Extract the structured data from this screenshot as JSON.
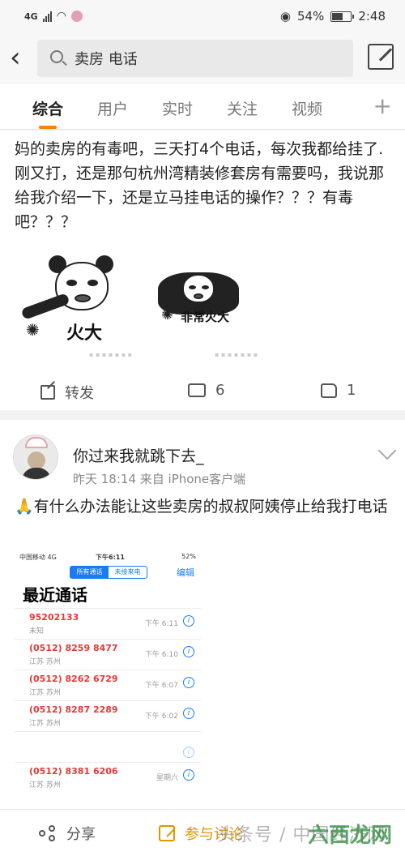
{
  "status_bar": {
    "network": "4G",
    "battery": "54%",
    "time": "2:48"
  },
  "search": {
    "query": "卖房 电话"
  },
  "tabs": [
    {
      "label": "综合",
      "active": true
    },
    {
      "label": "用户"
    },
    {
      "label": "实时"
    },
    {
      "label": "关注"
    },
    {
      "label": "视频"
    }
  ],
  "post1": {
    "text": "妈的卖房的有毒吧，三天打4个电话，每次我都给挂了.刚又打，还是那句杭州湾精装修套房有需要吗，我说那给我介绍一下，还是立马挂电话的操作？？？有毒吧？？？",
    "meme1_text": "火大",
    "meme2_text": "非常火大",
    "repost_label": "转发",
    "comment_count": "6",
    "like_count": "1"
  },
  "post2": {
    "username": "你过来我就跳下去_",
    "meta": "昨天 18:14  来自 iPhone客户端",
    "text": "有什么办法能让这些卖房的叔叔阿姨停止给我打电话",
    "screenshot": {
      "carrier": "中国移动  4G",
      "time": "下午6:11",
      "battery": "52%",
      "segment_all": "所有通话",
      "segment_missed": "未接来电",
      "edit": "编辑",
      "title": "最近通话",
      "calls": [
        {
          "number": "95202133",
          "location": "未知",
          "time": "下午 6:11"
        },
        {
          "number": "(0512) 8259 8477",
          "location": "江苏 苏州",
          "time": "下午 6:10"
        },
        {
          "number": "(0512) 8262 6729",
          "location": "江苏 苏州",
          "time": "下午 6:07"
        },
        {
          "number": "(0512) 8287 2289",
          "location": "江苏 苏州",
          "time": "下午 6:02"
        },
        {
          "number": "",
          "location": "",
          "time": ""
        },
        {
          "number": "(0512) 8381 6206",
          "location": "江苏 苏州",
          "time": "星期六"
        }
      ]
    }
  },
  "bottom_bar": {
    "share": "分享",
    "discuss": "参与讨论"
  },
  "watermark": {
    "left": "头条号 / 中国经济网",
    "right": "六西龙网"
  },
  "colors": {
    "accent": "#ff8200",
    "discuss": "#e39400",
    "ios_blue": "#1a7cf5",
    "missed_red": "#e53935"
  }
}
